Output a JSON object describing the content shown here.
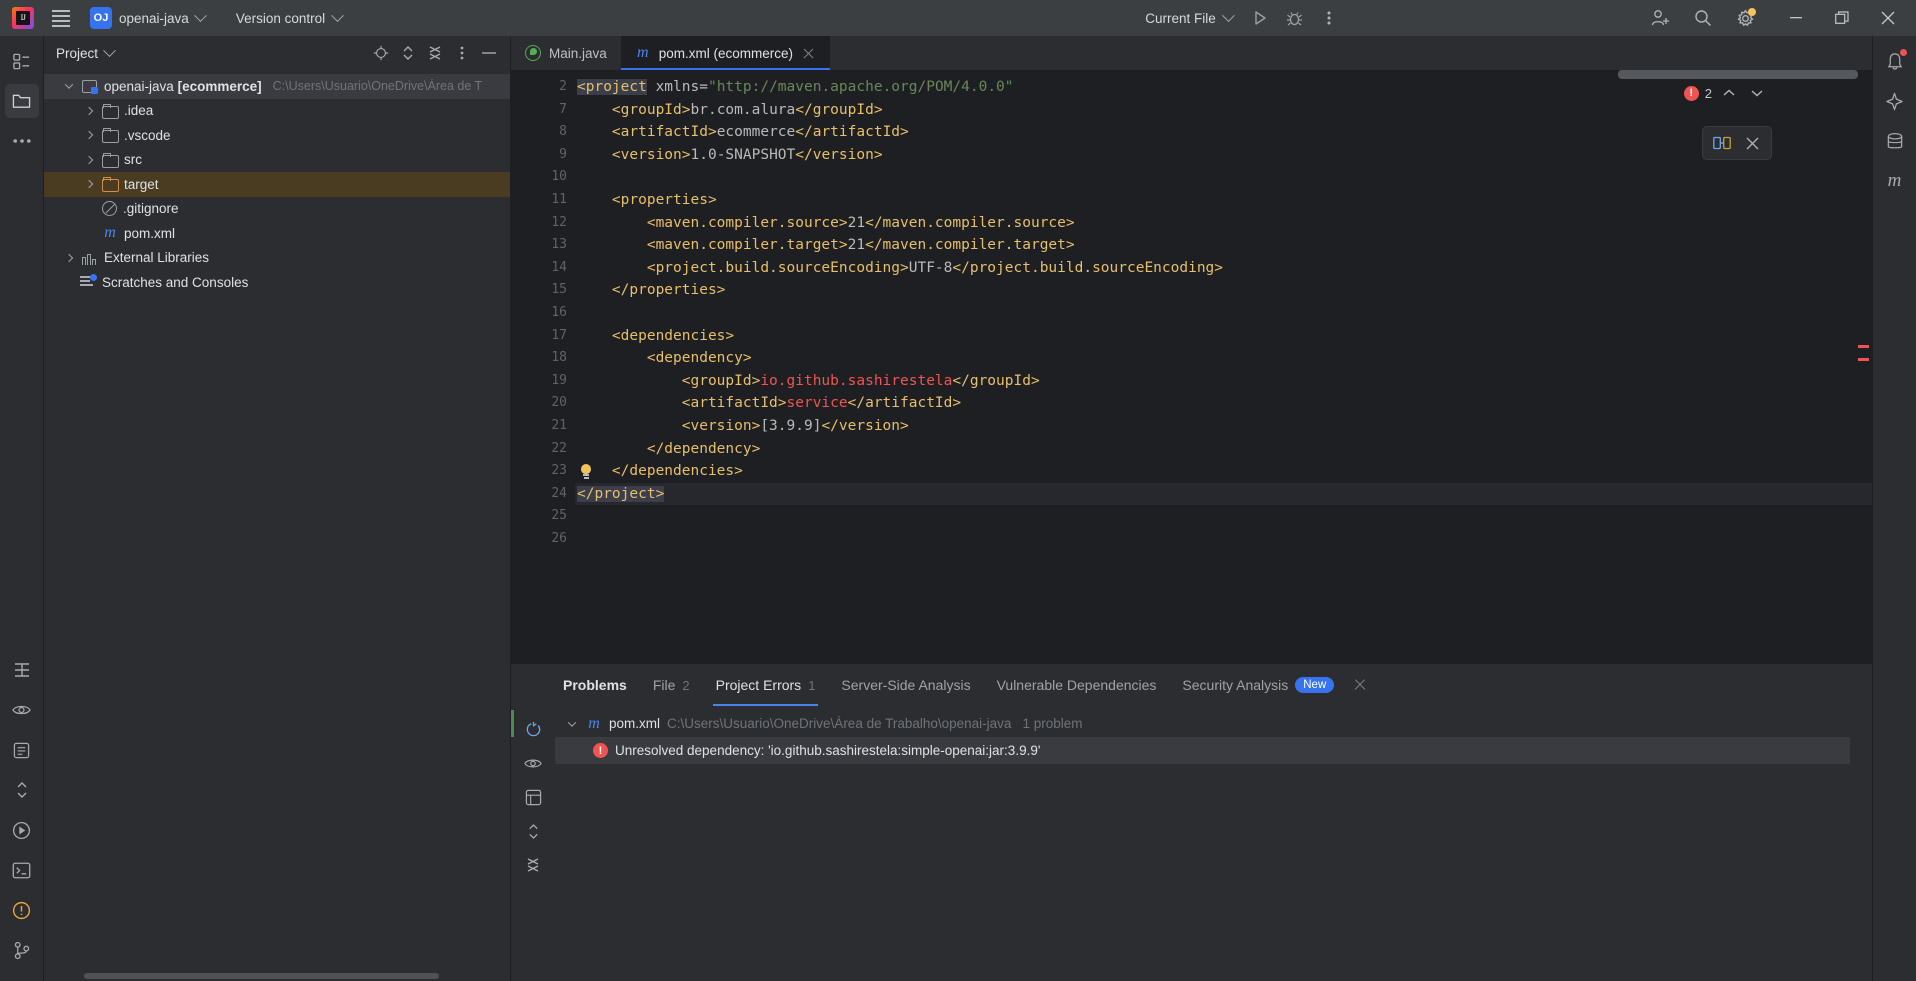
{
  "titlebar": {
    "menu_icon": "hamburger-icon",
    "project_badge": "OJ",
    "project_name": "openai-java",
    "version_control": "Version control",
    "run_config": "Current File",
    "run_icon": "run-icon",
    "debug_icon": "debug-icon",
    "more_icon": "more-vertical-icon",
    "add_user_icon": "add-user-icon",
    "search_icon": "search-icon",
    "settings_icon": "gear-icon",
    "minimize": "minimize-icon",
    "maximize": "maximize-icon",
    "close": "close-icon"
  },
  "left_rail": {
    "items": [
      {
        "name": "project-structure-icon"
      },
      {
        "name": "project-files-icon"
      },
      {
        "name": "more-tool-windows-icon"
      }
    ],
    "bottom": [
      {
        "name": "structure-icon"
      },
      {
        "name": "preview-icon"
      },
      {
        "name": "notes-icon"
      },
      {
        "name": "expand-collapse-icon"
      },
      {
        "name": "run-tool-icon"
      },
      {
        "name": "terminal-icon"
      },
      {
        "name": "problems-icon"
      },
      {
        "name": "git-branch-icon"
      }
    ]
  },
  "project_panel": {
    "title": "Project",
    "tools": [
      "locate-icon",
      "expand-all-icon",
      "collapse-all-icon",
      "options-icon",
      "hide-icon"
    ],
    "tree": [
      {
        "label": "openai-java",
        "bold": "[ecommerce]",
        "path": "C:\\Users\\Usuario\\OneDrive\\Área de T",
        "icon": "module-icon",
        "arrow": "open",
        "indent": 0,
        "state": "root"
      },
      {
        "label": ".idea",
        "icon": "folder-icon",
        "arrow": "closed",
        "indent": 1
      },
      {
        "label": ".vscode",
        "icon": "folder-icon",
        "arrow": "closed",
        "indent": 1
      },
      {
        "label": "src",
        "icon": "folder-icon",
        "arrow": "closed",
        "indent": 1
      },
      {
        "label": "target",
        "icon": "folder-icon-orange",
        "arrow": "closed",
        "indent": 1,
        "state": "target"
      },
      {
        "label": ".gitignore",
        "icon": "gitignore-icon",
        "arrow": "none",
        "indent": 1
      },
      {
        "label": "pom.xml",
        "icon": "maven-icon",
        "arrow": "none",
        "indent": 1
      },
      {
        "label": "External Libraries",
        "icon": "library-icon",
        "arrow": "closed",
        "indent": 0
      },
      {
        "label": "Scratches and Consoles",
        "icon": "scratches-icon",
        "arrow": "none",
        "indent": 0
      }
    ]
  },
  "editor": {
    "tabs": [
      {
        "label": "Main.java",
        "icon": "java-class-icon",
        "active": false,
        "closable": false
      },
      {
        "label": "pom.xml (ecommerce)",
        "icon": "maven-icon",
        "active": true,
        "closable": true
      }
    ],
    "error_count": "2",
    "float_toolbar": [
      "compare-icon",
      "close-icon"
    ],
    "lines": [
      {
        "num": "2",
        "bulb": false,
        "current": false,
        "tokens": [
          {
            "t": "<project",
            "c": "tag sel"
          },
          {
            "t": " ",
            "c": "txt"
          },
          {
            "t": "xmlns=",
            "c": "attr"
          },
          {
            "t": "\"http://maven.apache.org/POM/4.0.0\"",
            "c": "str"
          }
        ]
      },
      {
        "num": "7",
        "bulb": false,
        "current": false,
        "tokens": [
          {
            "t": "    <groupId>",
            "c": "tag"
          },
          {
            "t": "br.com.alura",
            "c": "txt"
          },
          {
            "t": "</groupId>",
            "c": "tag"
          }
        ]
      },
      {
        "num": "8",
        "bulb": false,
        "current": false,
        "tokens": [
          {
            "t": "    <artifactId>",
            "c": "tag"
          },
          {
            "t": "ecommerce",
            "c": "txt"
          },
          {
            "t": "</artifactId>",
            "c": "tag"
          }
        ]
      },
      {
        "num": "9",
        "bulb": false,
        "current": false,
        "tokens": [
          {
            "t": "    <version>",
            "c": "tag"
          },
          {
            "t": "1.0-SNAPSHOT",
            "c": "txt"
          },
          {
            "t": "</version>",
            "c": "tag"
          }
        ]
      },
      {
        "num": "10",
        "bulb": false,
        "current": false,
        "tokens": [
          {
            "t": "",
            "c": "txt"
          }
        ]
      },
      {
        "num": "11",
        "bulb": false,
        "current": false,
        "tokens": [
          {
            "t": "    <properties>",
            "c": "tag"
          }
        ]
      },
      {
        "num": "12",
        "bulb": false,
        "current": false,
        "tokens": [
          {
            "t": "        <maven.compiler.source>",
            "c": "tag"
          },
          {
            "t": "21",
            "c": "txt"
          },
          {
            "t": "</maven.compiler.source>",
            "c": "tag"
          }
        ]
      },
      {
        "num": "13",
        "bulb": false,
        "current": false,
        "tokens": [
          {
            "t": "        <maven.compiler.target>",
            "c": "tag"
          },
          {
            "t": "21",
            "c": "txt"
          },
          {
            "t": "</maven.compiler.target>",
            "c": "tag"
          }
        ]
      },
      {
        "num": "14",
        "bulb": false,
        "current": false,
        "tokens": [
          {
            "t": "        <project.build.sourceEncoding>",
            "c": "tag"
          },
          {
            "t": "UTF-8",
            "c": "txt"
          },
          {
            "t": "</project.build.sourceEncoding>",
            "c": "tag"
          }
        ]
      },
      {
        "num": "15",
        "bulb": false,
        "current": false,
        "tokens": [
          {
            "t": "    </properties>",
            "c": "tag"
          }
        ]
      },
      {
        "num": "16",
        "bulb": false,
        "current": false,
        "tokens": [
          {
            "t": "",
            "c": "txt"
          }
        ]
      },
      {
        "num": "17",
        "bulb": false,
        "current": false,
        "tokens": [
          {
            "t": "    <dependencies>",
            "c": "tag"
          }
        ]
      },
      {
        "num": "18",
        "bulb": false,
        "current": false,
        "tokens": [
          {
            "t": "        <dependency>",
            "c": "tag"
          }
        ]
      },
      {
        "num": "19",
        "bulb": false,
        "current": false,
        "tokens": [
          {
            "t": "            <groupId>",
            "c": "tag"
          },
          {
            "t": "io.github.sashirestela",
            "c": "err"
          },
          {
            "t": "</groupId>",
            "c": "tag"
          }
        ]
      },
      {
        "num": "20",
        "bulb": false,
        "current": false,
        "tokens": [
          {
            "t": "            <artifactId>",
            "c": "tag"
          },
          {
            "t": "service",
            "c": "err"
          },
          {
            "t": "</artifactId>",
            "c": "tag"
          }
        ]
      },
      {
        "num": "21",
        "bulb": false,
        "current": false,
        "tokens": [
          {
            "t": "            <version>",
            "c": "tag"
          },
          {
            "t": "[3.9.9]",
            "c": "txt"
          },
          {
            "t": "</version>",
            "c": "tag"
          }
        ]
      },
      {
        "num": "22",
        "bulb": false,
        "current": false,
        "tokens": [
          {
            "t": "        </dependency>",
            "c": "tag"
          }
        ]
      },
      {
        "num": "23",
        "bulb": true,
        "current": false,
        "tokens": [
          {
            "t": "    </dependencies>",
            "c": "tag"
          }
        ]
      },
      {
        "num": "24",
        "bulb": false,
        "current": true,
        "tokens": [
          {
            "t": "</project>",
            "c": "tag sel"
          }
        ]
      },
      {
        "num": "25",
        "bulb": false,
        "current": false,
        "tokens": [
          {
            "t": "",
            "c": "txt"
          }
        ]
      },
      {
        "num": "26",
        "bulb": false,
        "current": false,
        "tokens": [
          {
            "t": "",
            "c": "txt"
          }
        ]
      }
    ]
  },
  "problems": {
    "title": "Problems",
    "tabs": [
      {
        "label": "File",
        "count": "2",
        "active": false,
        "badge": ""
      },
      {
        "label": "Project Errors",
        "count": "1",
        "active": true,
        "badge": ""
      },
      {
        "label": "Server-Side Analysis",
        "count": "",
        "active": false,
        "badge": ""
      },
      {
        "label": "Vulnerable Dependencies",
        "count": "",
        "active": false,
        "badge": ""
      },
      {
        "label": "Security Analysis",
        "count": "",
        "active": false,
        "badge": "New"
      }
    ],
    "rail": [
      "refresh-icon",
      "eye-icon",
      "grouping-icon",
      "expand-icon",
      "collapse-icon"
    ],
    "rows": [
      {
        "type": "file",
        "icon": "maven-icon",
        "label": "pom.xml",
        "path": "C:\\Users\\Usuario\\OneDrive\\Área de Trabalho\\openai-java",
        "count": "1 problem"
      },
      {
        "type": "error",
        "icon": "error-icon",
        "label": "Unresolved dependency: 'io.github.sashirestela:simple-openai:jar:3.9.9'"
      }
    ]
  },
  "right_rail": {
    "items": [
      {
        "name": "notifications-icon",
        "dot": true
      },
      {
        "name": "ai-assistant-icon",
        "dot": false
      },
      {
        "name": "database-icon",
        "dot": false
      },
      {
        "name": "maven-icon",
        "dot": false
      }
    ]
  },
  "colors": {
    "accent": "#3573f0",
    "error": "#f05450",
    "warning": "#f2c55c",
    "bg_window": "#2b2d30",
    "bg_editor": "#1e1f22"
  }
}
